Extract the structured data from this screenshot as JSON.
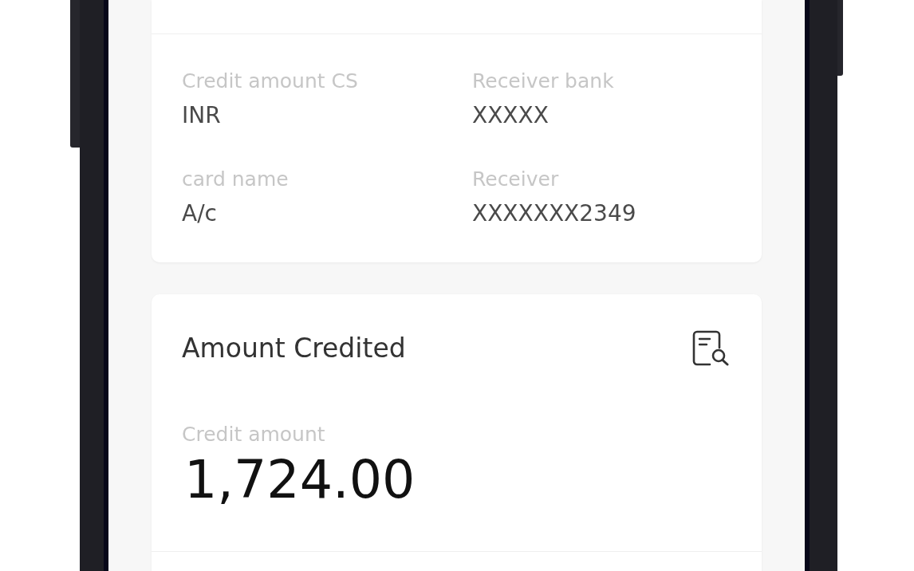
{
  "details": [
    {
      "label": "Credit amount CS",
      "value": "INR"
    },
    {
      "label": "Receiver bank",
      "value": "XXXXX"
    },
    {
      "label": "card name",
      "value": "A/c"
    },
    {
      "label": "Receiver",
      "value": "XXXXXXX2349"
    }
  ],
  "amount_card": {
    "title": "Amount Credited",
    "label": "Credit amount",
    "value": "1,724.00"
  }
}
